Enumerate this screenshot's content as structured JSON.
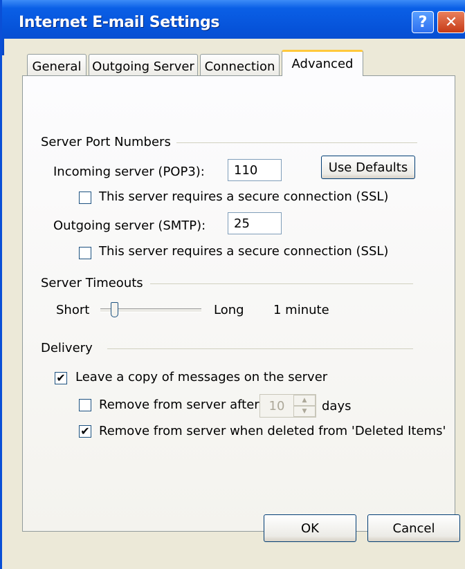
{
  "window": {
    "title": "Internet E-mail Settings",
    "help_icon": "?",
    "close_icon": "✕"
  },
  "tabs": [
    {
      "label": "General",
      "active": false
    },
    {
      "label": "Outgoing Server",
      "active": false
    },
    {
      "label": "Connection",
      "active": false
    },
    {
      "label": "Advanced",
      "active": true
    }
  ],
  "server_ports": {
    "group_label": "Server Port Numbers",
    "incoming_label": "Incoming server (POP3):",
    "incoming_value": "110",
    "incoming_ssl_label": "This server requires a secure connection (SSL)",
    "incoming_ssl_checked": false,
    "use_defaults_label": "Use Defaults",
    "outgoing_label": "Outgoing server (SMTP):",
    "outgoing_value": "25",
    "outgoing_ssl_label": "This server requires a secure connection (SSL)",
    "outgoing_ssl_checked": false
  },
  "timeouts": {
    "group_label": "Server Timeouts",
    "short_label": "Short",
    "long_label": "Long",
    "value_text": "1 minute",
    "slider_level": 0.1
  },
  "delivery": {
    "group_label": "Delivery",
    "leave_copy_label": "Leave a copy of messages on the server",
    "leave_copy_checked": true,
    "remove_after_label": "Remove from server after",
    "remove_after_checked": false,
    "remove_after_days": "10",
    "days_label": "days",
    "remove_deleted_label": "Remove from server when deleted from 'Deleted Items'",
    "remove_deleted_checked": true
  },
  "buttons": {
    "ok_label": "OK",
    "cancel_label": "Cancel"
  },
  "colors": {
    "titlebar": "#0652d8",
    "dialog_bg": "#ece9d8",
    "close_button": "#c63a16",
    "check_mark": "#000000"
  }
}
